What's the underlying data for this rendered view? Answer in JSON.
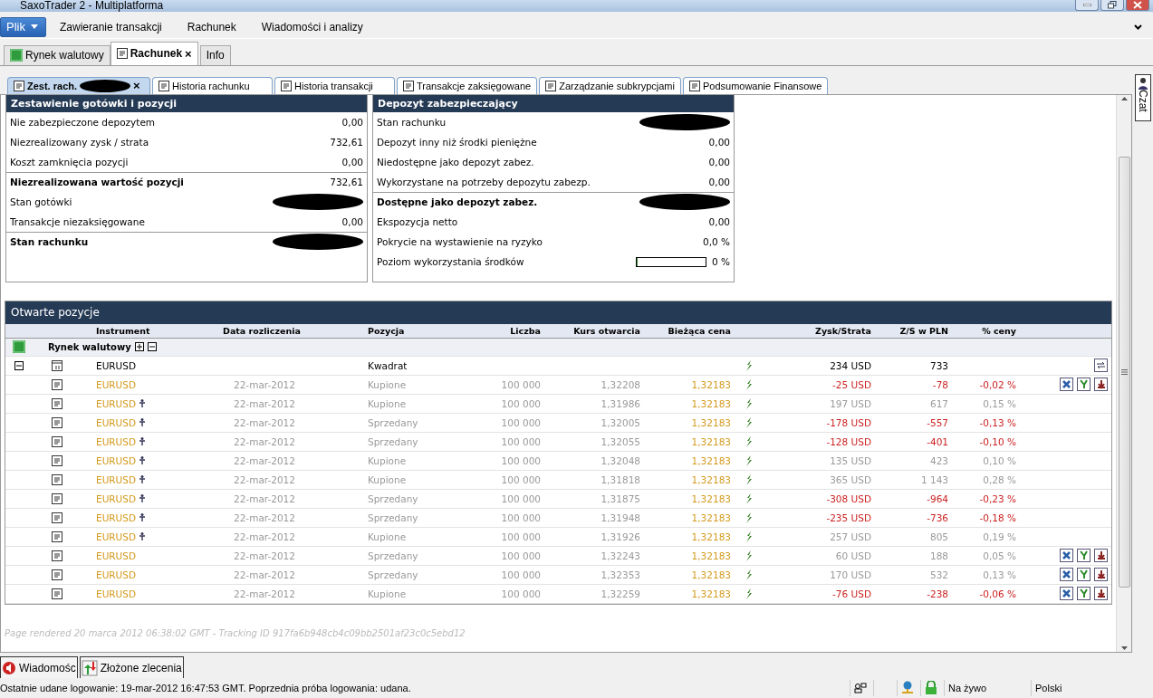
{
  "window": {
    "title": "SaxoTrader 2 - Multiplatforma"
  },
  "menu": {
    "file": "Plik",
    "items": [
      "Zawieranie transakcji",
      "Rachunek",
      "Wiadomości i analizy"
    ]
  },
  "tabs": [
    {
      "label": "Rynek walutowy",
      "selected": false,
      "kind": "fx"
    },
    {
      "label": "Rachunek",
      "selected": true,
      "kind": "doc",
      "close": "×"
    },
    {
      "label": "Info",
      "selected": false,
      "kind": "none"
    }
  ],
  "subtabs": [
    {
      "label": "Zest. rach.",
      "selected": true,
      "redacted": true,
      "close": "×"
    },
    {
      "label": "Historia rachunku",
      "selected": false
    },
    {
      "label": "Historia transakcji",
      "selected": false
    },
    {
      "label": "Transakcje zaksięgowane",
      "selected": false
    },
    {
      "label": "Zarządzanie subkrypcjami",
      "selected": false
    },
    {
      "label": "Podsumowanie Finansowe",
      "selected": false
    }
  ],
  "cash_panel": {
    "title": "Zestawienie gotówki i pozycji",
    "rows": [
      {
        "label": "Nie zabezpieczone depozytem",
        "value": "0,00",
        "bold": false,
        "separator": false,
        "kind": "text"
      },
      {
        "label": "Niezrealizowany zysk / strata",
        "value": "732,61",
        "bold": false,
        "separator": false,
        "kind": "text"
      },
      {
        "label": "Koszt zamknięcia pozycji",
        "value": "0,00",
        "bold": false,
        "separator": false,
        "kind": "text"
      },
      {
        "label": "Niezrealizowana wartość pozycji",
        "value": "732,61",
        "bold": true,
        "separator": true,
        "kind": "text"
      },
      {
        "label": "Stan gotówki",
        "bold": false,
        "separator": false,
        "redacted": true
      },
      {
        "label": "Transakcje niezaksięgowane",
        "value": "0,00",
        "bold": false,
        "separator": false,
        "kind": "text"
      },
      {
        "label": "Stan rachunku",
        "bold": true,
        "separator": true,
        "redacted": true
      }
    ]
  },
  "margin_panel": {
    "title": "Depozyt zabezpieczający",
    "rows": [
      {
        "label": "Stan rachunku",
        "bold": false,
        "separator": false,
        "redacted": true
      },
      {
        "label": "Depozyt inny niż środki pieniężne",
        "value": "0,00",
        "bold": false,
        "separator": false,
        "kind": "text"
      },
      {
        "label": "Niedostępne jako depozyt zabez.",
        "value": "0,00",
        "bold": false,
        "separator": false,
        "kind": "text"
      },
      {
        "label": "Wykorzystane na potrzeby depozytu zabezp.",
        "value": "0,00",
        "bold": false,
        "separator": false,
        "kind": "text"
      },
      {
        "label": "Dostępne jako depozyt zabez.",
        "bold": true,
        "separator": true,
        "redacted": true
      },
      {
        "label": "Ekspozycja netto",
        "value": "0,00",
        "bold": false,
        "separator": false,
        "kind": "text"
      },
      {
        "label": "Pokrycie na wystawienie na ryzyko",
        "value": "0,0 %",
        "bold": false,
        "separator": false,
        "kind": "text"
      },
      {
        "label": "Poziom wykorzystania środków",
        "value": "0 %",
        "level": 0,
        "bold": false,
        "separator": false,
        "kind": "meter"
      }
    ]
  },
  "positions": {
    "title": "Otwarte pozycje",
    "columns": [
      "Instrument",
      "Data rozliczenia",
      "Pozycja",
      "Liczba",
      "Kurs otwarcia",
      "Bieżąca cena",
      "Zysk/Strata",
      "Z/S w PLN",
      "% ceny"
    ],
    "group": "Rynek walutowy",
    "summary": {
      "instrument": "EURUSD",
      "position": "Kwadrat",
      "pl": "234 USD",
      "pl_pln": "733",
      "expanded": true
    },
    "rows": [
      {
        "instrument": "EURUSD",
        "flag": false,
        "date": "22-mar-2012",
        "position": "Kupione",
        "amount": "100 000",
        "open": "1,32208",
        "current": "1,32183",
        "pl": "-25 USD",
        "pl_pln": "-78",
        "pct": "-0,02 %",
        "negative": true,
        "actions": true
      },
      {
        "instrument": "EURUSD",
        "flag": true,
        "date": "22-mar-2012",
        "position": "Kupione",
        "amount": "100 000",
        "open": "1,31986",
        "current": "1,32183",
        "pl": "197 USD",
        "pl_pln": "617",
        "pct": "0,15 %",
        "negative": false,
        "actions": false
      },
      {
        "instrument": "EURUSD",
        "flag": true,
        "date": "22-mar-2012",
        "position": "Sprzedany",
        "amount": "100 000",
        "open": "1,32005",
        "current": "1,32183",
        "pl": "-178 USD",
        "pl_pln": "-557",
        "pct": "-0,13 %",
        "negative": true,
        "actions": false
      },
      {
        "instrument": "EURUSD",
        "flag": true,
        "date": "22-mar-2012",
        "position": "Sprzedany",
        "amount": "100 000",
        "open": "1,32055",
        "current": "1,32183",
        "pl": "-128 USD",
        "pl_pln": "-401",
        "pct": "-0,10 %",
        "negative": true,
        "actions": false
      },
      {
        "instrument": "EURUSD",
        "flag": true,
        "date": "22-mar-2012",
        "position": "Kupione",
        "amount": "100 000",
        "open": "1,32048",
        "current": "1,32183",
        "pl": "135 USD",
        "pl_pln": "423",
        "pct": "0,10 %",
        "negative": false,
        "actions": false
      },
      {
        "instrument": "EURUSD",
        "flag": true,
        "date": "22-mar-2012",
        "position": "Kupione",
        "amount": "100 000",
        "open": "1,31818",
        "current": "1,32183",
        "pl": "365 USD",
        "pl_pln": "1 143",
        "pct": "0,28 %",
        "negative": false,
        "actions": false
      },
      {
        "instrument": "EURUSD",
        "flag": true,
        "date": "22-mar-2012",
        "position": "Sprzedany",
        "amount": "100 000",
        "open": "1,31875",
        "current": "1,32183",
        "pl": "-308 USD",
        "pl_pln": "-964",
        "pct": "-0,23 %",
        "negative": true,
        "actions": false
      },
      {
        "instrument": "EURUSD",
        "flag": true,
        "date": "22-mar-2012",
        "position": "Sprzedany",
        "amount": "100 000",
        "open": "1,31948",
        "current": "1,32183",
        "pl": "-235 USD",
        "pl_pln": "-736",
        "pct": "-0,18 %",
        "negative": true,
        "actions": false
      },
      {
        "instrument": "EURUSD",
        "flag": true,
        "date": "22-mar-2012",
        "position": "Kupione",
        "amount": "100 000",
        "open": "1,31926",
        "current": "1,32183",
        "pl": "257 USD",
        "pl_pln": "805",
        "pct": "0,19 %",
        "negative": false,
        "actions": false
      },
      {
        "instrument": "EURUSD",
        "flag": false,
        "date": "22-mar-2012",
        "position": "Sprzedany",
        "amount": "100 000",
        "open": "1,32243",
        "current": "1,32183",
        "pl": "60 USD",
        "pl_pln": "188",
        "pct": "0,05 %",
        "negative": false,
        "actions": true
      },
      {
        "instrument": "EURUSD",
        "flag": false,
        "date": "22-mar-2012",
        "position": "Sprzedany",
        "amount": "100 000",
        "open": "1,32353",
        "current": "1,32183",
        "pl": "170 USD",
        "pl_pln": "532",
        "pct": "0,13 %",
        "negative": false,
        "actions": true
      },
      {
        "instrument": "EURUSD",
        "flag": false,
        "date": "22-mar-2012",
        "position": "Kupione",
        "amount": "100 000",
        "open": "1,32259",
        "current": "1,32183",
        "pl": "-76 USD",
        "pl_pln": "-238",
        "pct": "-0,06 %",
        "negative": true,
        "actions": true
      }
    ]
  },
  "footer": "Page rendered 20 marca 2012 06:38:02 GMT - Tracking ID 917fa6b948cb4c09bb2501af23c0c5ebd12",
  "side_tab": "Czat",
  "dock_tabs": [
    {
      "label": "Wiadomośc",
      "kind": "messages"
    },
    {
      "label": "Złożone zlecenia",
      "kind": "orders"
    }
  ],
  "status_bar": {
    "text": "Ostatnie udane logowanie: 19-mar-2012 16:47:53 GMT. Poprzednia próba logowania: udana.",
    "mode": "Na żywo",
    "language": "Polski"
  }
}
